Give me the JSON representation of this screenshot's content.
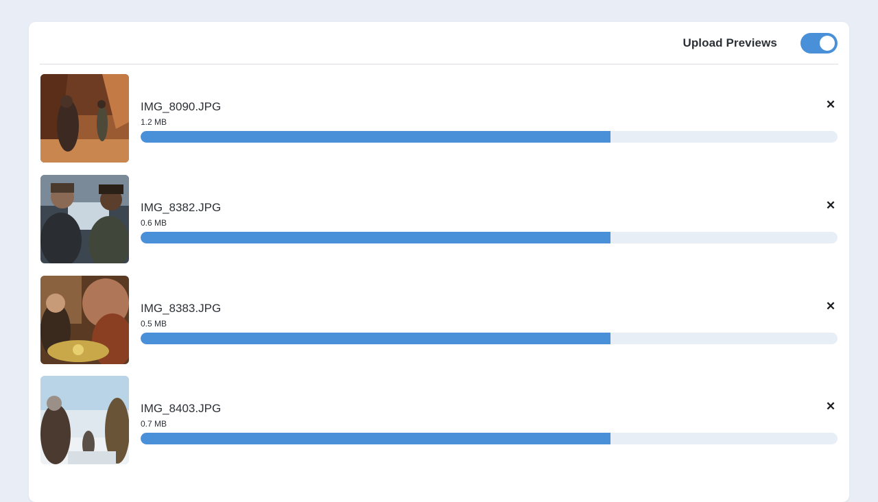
{
  "header": {
    "toggle_label": "Upload Previews",
    "toggle_on": true
  },
  "colors": {
    "accent": "#4a90d9",
    "track": "#e8eef6",
    "background": "#e9eef6"
  },
  "files": [
    {
      "name": "IMG_8090.JPG",
      "size": "1.2 MB",
      "progress": 0.674
    },
    {
      "name": "IMG_8382.JPG",
      "size": "0.6 MB",
      "progress": 0.674
    },
    {
      "name": "IMG_8383.JPG",
      "size": "0.5 MB",
      "progress": 0.674
    },
    {
      "name": "IMG_8403.JPG",
      "size": "0.7 MB",
      "progress": 0.674
    }
  ],
  "icons": {
    "remove": "close-icon",
    "remove_glyph": "✕"
  }
}
